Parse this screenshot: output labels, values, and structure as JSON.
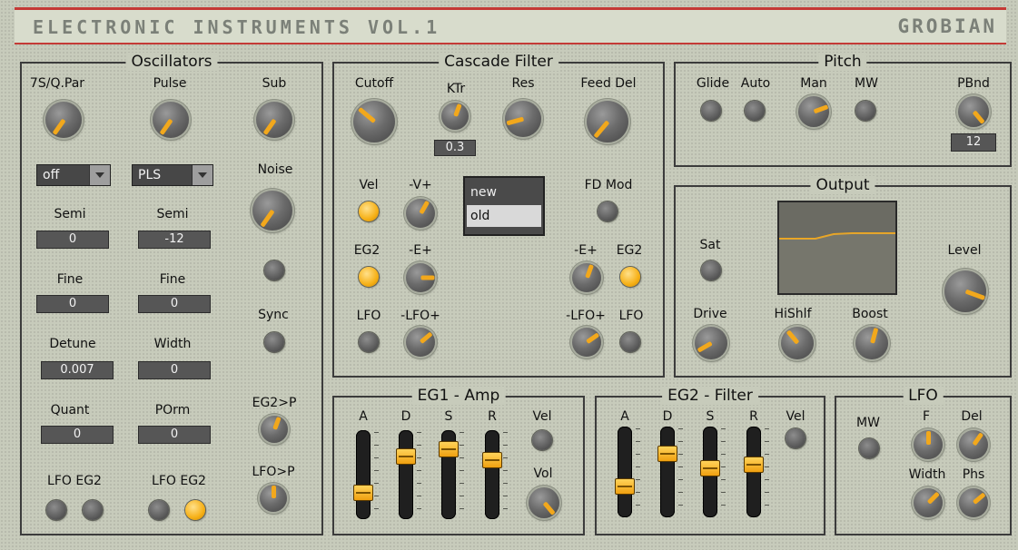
{
  "header": {
    "title": "ELECTRONIC INSTRUMENTS VOL.1",
    "brand": "GROBIAN"
  },
  "oscillators": {
    "title": "Oscillators",
    "labels": {
      "sq_par": "7S/Q.Par",
      "pulse": "Pulse",
      "sub": "Sub",
      "noise": "Noise",
      "semi1": "Semi",
      "semi2": "Semi",
      "fine1": "Fine",
      "fine2": "Fine",
      "detune": "Detune",
      "width": "Width",
      "quant": "Quant",
      "porm": "POrm",
      "sync": "Sync",
      "eg2p": "EG2>P",
      "lfop": "LFO>P",
      "lfo_eg2_a": "LFO EG2",
      "lfo_eg2_b": "LFO EG2"
    },
    "osc1_wave": "off",
    "osc2_wave": "PLS",
    "semi1": "0",
    "semi2": "-12",
    "fine1": "0",
    "fine2": "0",
    "detune": "0.007",
    "width": "0",
    "quant": "0",
    "porm": "0"
  },
  "filter": {
    "title": "Cascade Filter",
    "labels": {
      "cutoff": "Cutoff",
      "ktr": "KTr",
      "res": "Res",
      "feed_del": "Feed Del",
      "vel": "Vel",
      "v_amt": "-V+",
      "eg2": "EG2",
      "e_amt": "-E+",
      "lfo": "LFO",
      "lfo_amt": "-LFO+",
      "fd_mod": "FD Mod",
      "r_e_amt": "-E+",
      "r_eg2": "EG2",
      "r_lfo_amt": "-LFO+",
      "r_lfo": "LFO"
    },
    "ktr_value": "0.3",
    "mode_options": [
      "new",
      "old"
    ],
    "mode_selected": "old"
  },
  "pitch": {
    "title": "Pitch",
    "labels": {
      "glide": "Glide",
      "auto": "Auto",
      "man": "Man",
      "mw": "MW",
      "pbnd": "PBnd"
    },
    "pbnd_value": "12"
  },
  "output": {
    "title": "Output",
    "labels": {
      "sat": "Sat",
      "drive": "Drive",
      "hishlf": "HiShlf",
      "boost": "Boost",
      "level": "Level"
    },
    "curve_color": "#f2a81c"
  },
  "eg1": {
    "title": "EG1 - Amp",
    "labels": {
      "a": "A",
      "d": "D",
      "s": "S",
      "r": "R",
      "vel": "Vel",
      "vol": "Vol"
    },
    "levels": {
      "a": 0.25,
      "d": 0.75,
      "s": 0.85,
      "r": 0.7
    }
  },
  "eg2": {
    "title": "EG2 - Filter",
    "labels": {
      "a": "A",
      "d": "D",
      "s": "S",
      "r": "R",
      "vel": "Vel"
    },
    "levels": {
      "a": 0.3,
      "d": 0.75,
      "s": 0.55,
      "r": 0.6
    }
  },
  "lfo": {
    "title": "LFO",
    "labels": {
      "mw": "MW",
      "f": "F",
      "del": "Del",
      "width": "Width",
      "phs": "Phs"
    }
  },
  "colors": {
    "accent": "#f2a81c",
    "header_line": "#c43a36",
    "panel_bg": "#c7cbbb"
  }
}
